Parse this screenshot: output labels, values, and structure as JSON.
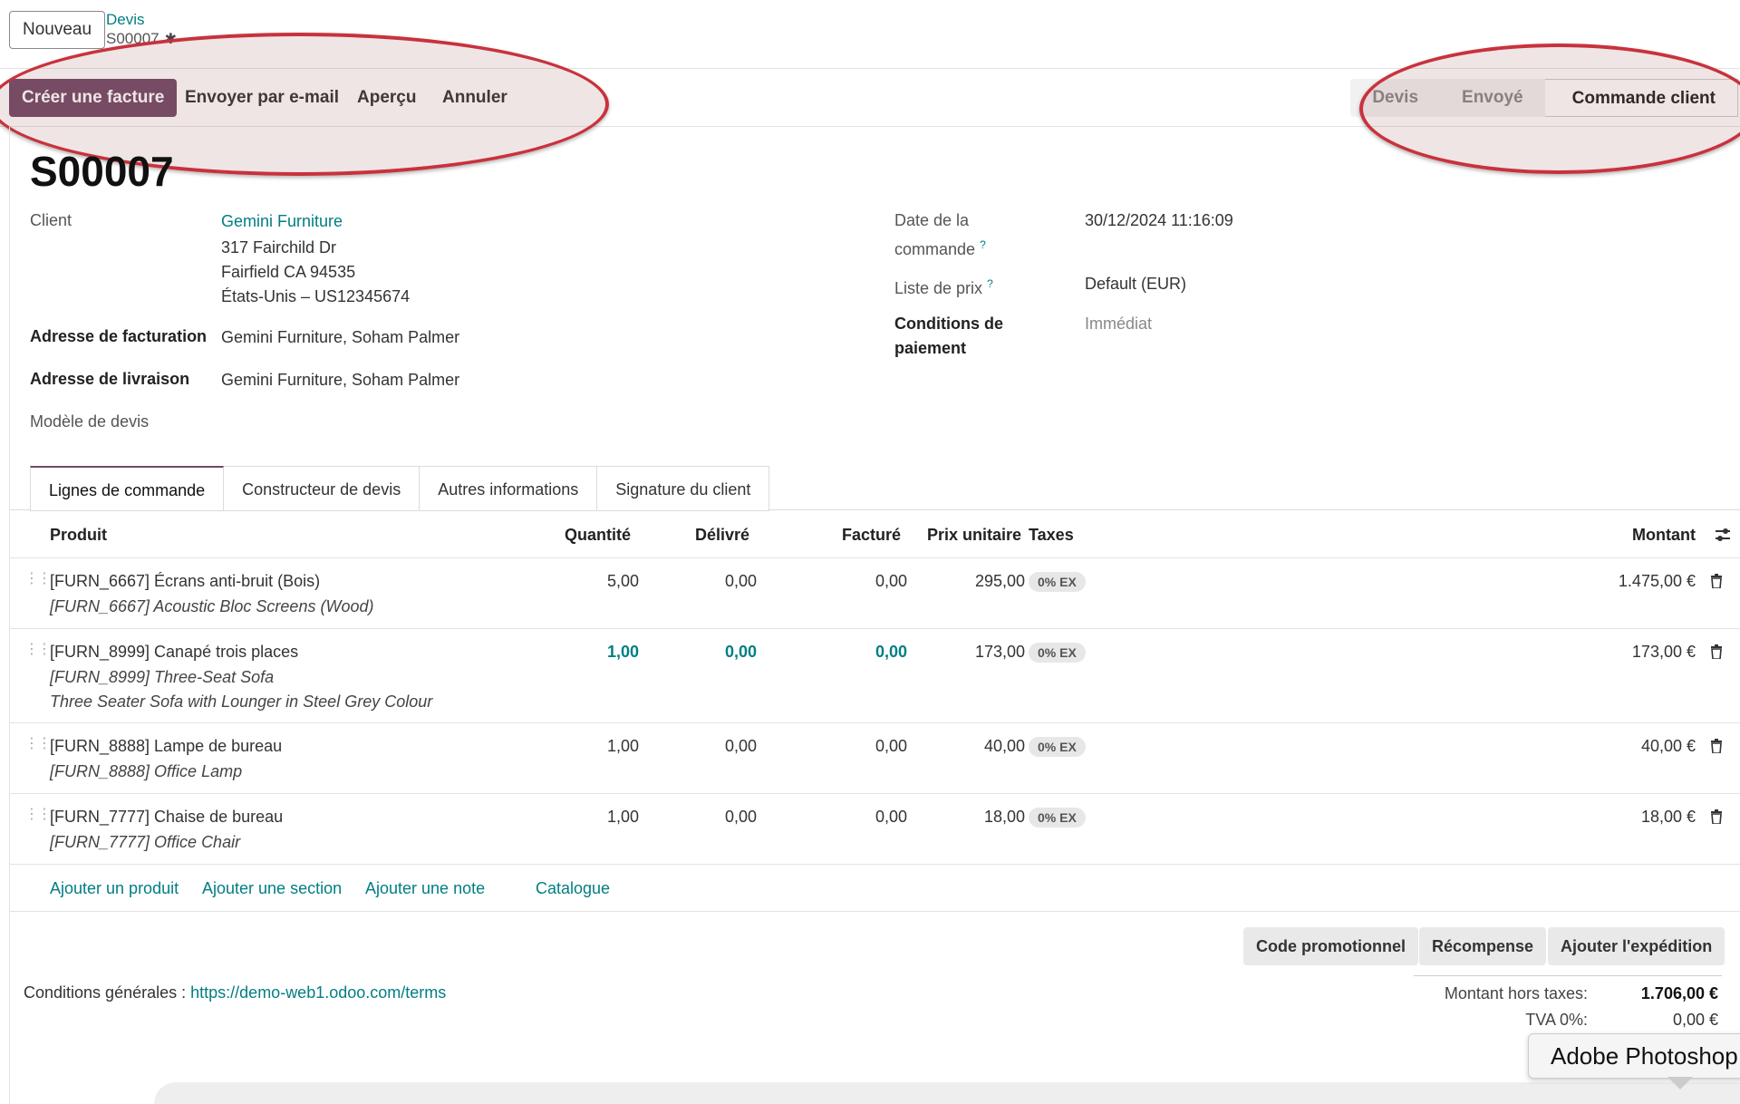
{
  "topbar": {
    "new_label": "Nouveau",
    "breadcrumb_parent": "Devis",
    "breadcrumb_current": "S00007"
  },
  "actions": {
    "create_invoice": "Créer une facture",
    "send_email": "Envoyer par e-mail",
    "preview": "Aperçu",
    "cancel": "Annuler"
  },
  "statusbar": {
    "stages": [
      "Devis",
      "Envoyé",
      "Commande client"
    ],
    "active": "Commande client"
  },
  "form": {
    "title": "S00007",
    "client_label": "Client",
    "client_name": "Gemini Furniture",
    "client_address": [
      "317 Fairchild Dr",
      "Fairfield CA 94535",
      "États-Unis – US12345674"
    ],
    "invoice_address_label": "Adresse de facturation",
    "invoice_address": "Gemini Furniture, Soham Palmer",
    "delivery_address_label": "Adresse de livraison",
    "delivery_address": "Gemini Furniture, Soham Palmer",
    "template_label": "Modèle de devis",
    "order_date_label_1": "Date de la",
    "order_date_label_2": "commande",
    "order_date": "30/12/2024 11:16:09",
    "pricelist_label": "Liste de prix",
    "pricelist": "Default (EUR)",
    "payment_terms_label_1": "Conditions de",
    "payment_terms_label_2": "paiement",
    "payment_terms": "Immédiat",
    "help_mark": "?"
  },
  "tabs": [
    "Lignes de commande",
    "Constructeur de devis",
    "Autres informations",
    "Signature du client"
  ],
  "table": {
    "headers": {
      "product": "Produit",
      "quantity": "Quantité",
      "delivered": "Délivré",
      "invoiced": "Facturé",
      "unit_price": "Prix unitaire",
      "taxes": "Taxes",
      "amount": "Montant"
    },
    "rows": [
      {
        "name": "[FURN_6667] Écrans anti-bruit (Bois)",
        "desc1": "[FURN_6667] Acoustic Bloc Screens (Wood)",
        "desc2": "",
        "qty": "5,00",
        "delivered": "0,00",
        "invoiced": "0,00",
        "price": "295,00",
        "tax": "0% EX",
        "amount": "1.475,00 €"
      },
      {
        "name": "[FURN_8999] Canapé trois places",
        "desc1": "[FURN_8999] Three-Seat Sofa",
        "desc2": "Three Seater Sofa with Lounger in Steel Grey Colour",
        "qty": "1,00",
        "delivered": "0,00",
        "invoiced": "0,00",
        "price": "173,00",
        "tax": "0% EX",
        "amount": "173,00 €"
      },
      {
        "name": "[FURN_8888] Lampe de bureau",
        "desc1": "[FURN_8888] Office Lamp",
        "desc2": "",
        "qty": "1,00",
        "delivered": "0,00",
        "invoiced": "0,00",
        "price": "40,00",
        "tax": "0% EX",
        "amount": "40,00 €"
      },
      {
        "name": "[FURN_7777] Chaise de bureau",
        "desc1": "[FURN_7777] Office Chair",
        "desc2": "",
        "qty": "1,00",
        "delivered": "0,00",
        "invoiced": "0,00",
        "price": "18,00",
        "tax": "0% EX",
        "amount": "18,00 €"
      }
    ],
    "add_product": "Ajouter un produit",
    "add_section": "Ajouter une section",
    "add_note": "Ajouter une note",
    "catalog": "Catalogue"
  },
  "bottom_buttons": {
    "promo": "Code promotionnel",
    "reward": "Récompense",
    "shipping": "Ajouter l'expédition"
  },
  "terms": {
    "label": "Conditions générales :",
    "url": "https://demo-web1.odoo.com/terms"
  },
  "totals": {
    "untaxed_label": "Montant hors taxes:",
    "untaxed": "1.706,00 €",
    "vat_label": "TVA 0%:",
    "vat": "0,00 €"
  },
  "tooltip": "Adobe Photoshop",
  "colors": {
    "primary": "#714b67",
    "link": "#017e84",
    "annotation": "#c8323c"
  }
}
